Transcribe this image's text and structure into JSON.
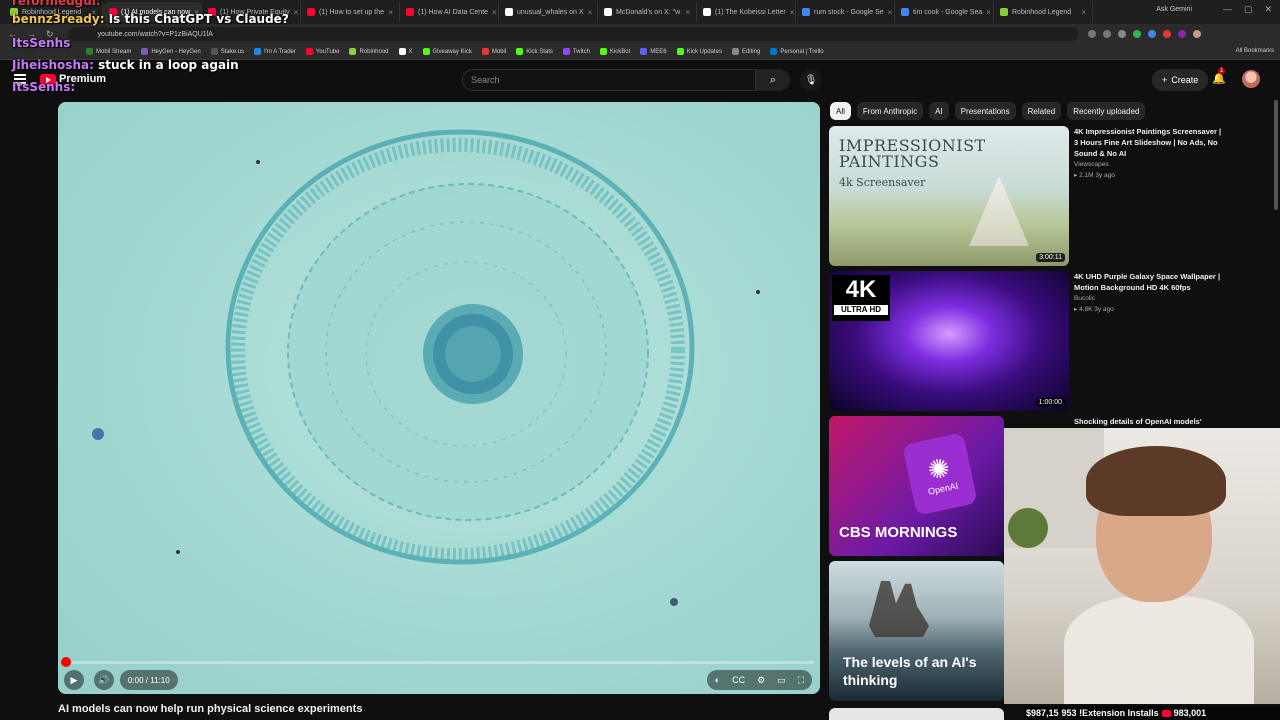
{
  "browser": {
    "tabs": [
      {
        "label": "Robinhood Legend",
        "color": "#8bcf3a"
      },
      {
        "label": "(1) AI models can now",
        "color": "#ff0033",
        "active": true
      },
      {
        "label": "(1) How Private Equity",
        "color": "#ff0033"
      },
      {
        "label": "(1) How to set up the",
        "color": "#ff0033"
      },
      {
        "label": "(1) How AI Data Cente",
        "color": "#ff0033"
      },
      {
        "label": "unusual_whales on X",
        "color": "#ffffff"
      },
      {
        "label": "McDonald's on X: \"w",
        "color": "#ffffff"
      },
      {
        "label": "(1) The Kobeissi Letter",
        "color": "#ffffff"
      },
      {
        "label": "rum stock - Google Se",
        "color": "#4285f4"
      },
      {
        "label": "tim cook - Google Sea",
        "color": "#4285f4"
      },
      {
        "label": "Robinhood Legend",
        "color": "#8bcf3a"
      }
    ],
    "gemini_label": "Ask Gemini",
    "url": "youtube.com/watch?v=P1zBiAQU1lA",
    "bookmarks": [
      {
        "label": "Mobil Stream",
        "color": "#2e7d32"
      },
      {
        "label": "HeyGen - HeyGen",
        "color": "#7e57c2"
      },
      {
        "label": "Stake.us",
        "color": "#555555"
      },
      {
        "label": "I'm A Trader",
        "color": "#1e88e5"
      },
      {
        "label": "YouTube",
        "color": "#ff0033"
      },
      {
        "label": "Robinhood",
        "color": "#8bcf3a"
      },
      {
        "label": "X",
        "color": "#ffffff"
      },
      {
        "label": "Giveaway Kick",
        "color": "#53fc18"
      },
      {
        "label": "Mobil",
        "color": "#e53935"
      },
      {
        "label": "Kick Stats",
        "color": "#53fc18"
      },
      {
        "label": "Twitch",
        "color": "#9146ff"
      },
      {
        "label": "KickBot",
        "color": "#53fc18"
      },
      {
        "label": "MEE6",
        "color": "#5865f2"
      },
      {
        "label": "Kick Updates",
        "color": "#53fc18"
      },
      {
        "label": "Editing",
        "color": "#888888"
      },
      {
        "label": "Personal | Trello",
        "color": "#0079bf"
      }
    ],
    "all_bookmarks": "All Bookmarks"
  },
  "chat": [
    {
      "user": "reformedgul:",
      "message": ""
    },
    {
      "user": "bennz3ready:",
      "message": "Is this ChatGPT vs Claude?"
    },
    {
      "user": "ItsSenhs",
      "message": ""
    },
    {
      "user": "Jiheishosha:",
      "message": "stuck in a loop again"
    },
    {
      "user": "ItsSenhs:",
      "message": ""
    }
  ],
  "youtube": {
    "logo_text": "Premium",
    "search_placeholder": "Search",
    "create_label": "Create",
    "notification_count": "1"
  },
  "player": {
    "time": "0:00 / 11:10",
    "progress_percent": 0.5,
    "title": "AI models can now help run physical science experiments"
  },
  "chips": [
    "All",
    "From Anthropic",
    "AI",
    "Presentations",
    "Related",
    "Recently uploaded"
  ],
  "recommendations": [
    {
      "thumb_text_big": "IMPRESSIONIST PAINTINGS",
      "thumb_text_small": "4k Screensaver",
      "duration": "3:00:11",
      "title": "4K Impressionist Paintings Screensaver | 3 Hours Fine Art Slideshow | No Ads, No Sound & No AI",
      "channel": "Viewscapes",
      "stats": "▸ 2.1M  3y ago"
    },
    {
      "thumb_text_big": "4K",
      "thumb_text_small": "ULTRA HD",
      "duration": "1:00:00",
      "title": "4K UHD Purple Galaxy Space Wallpaper | Motion Background HD 4K 60fps",
      "channel": "Bucolic",
      "stats": "▸ 4.8K  3y ago"
    },
    {
      "thumb_text_big": "OpenAI",
      "thumb_text_small": "CBS MORNINGS",
      "title": "Shocking details of OpenAI models'"
    },
    {
      "thumb_text_big": "The levels of an AI's thinking"
    }
  ],
  "ticker": {
    "text": "$987,15",
    "extra": "953 !Extension Installs",
    "count": "983,001"
  }
}
